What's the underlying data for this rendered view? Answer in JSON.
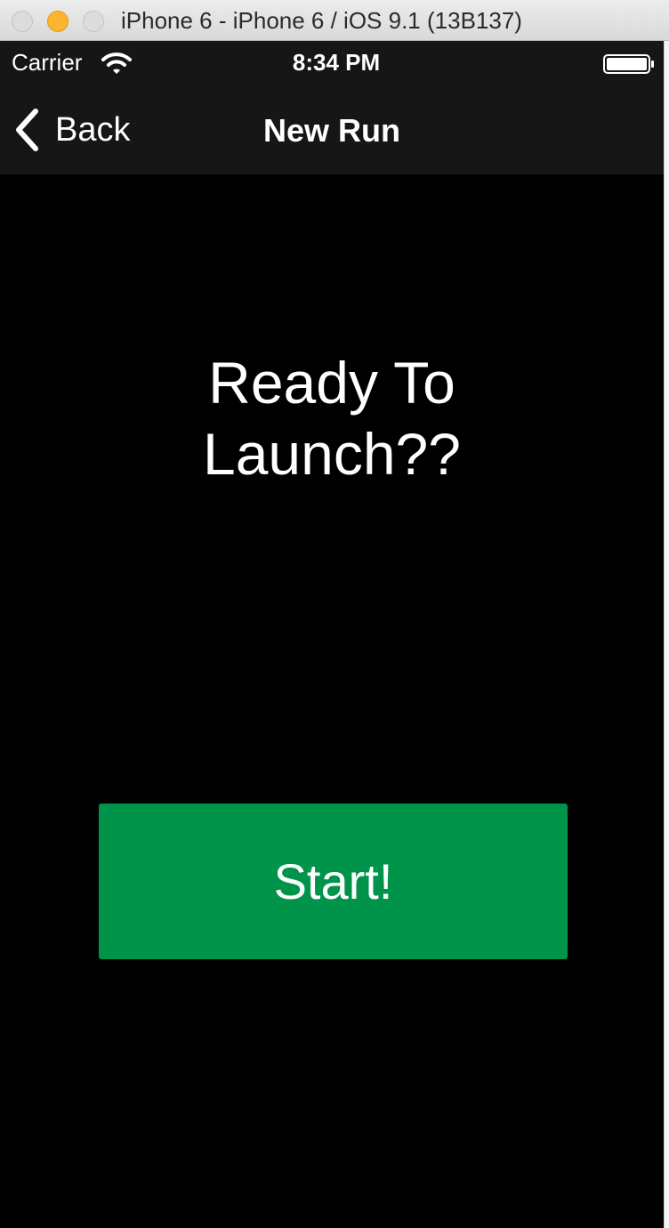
{
  "window": {
    "title": "iPhone 6 - iPhone 6 / iOS 9.1 (13B137)"
  },
  "status_bar": {
    "carrier": "Carrier",
    "time": "8:34 PM",
    "wifi_icon": "wifi-icon",
    "battery_icon": "battery-icon"
  },
  "nav_bar": {
    "back_label": "Back",
    "back_icon": "chevron-left-icon",
    "title": "New Run"
  },
  "main": {
    "headline_line1": "Ready To",
    "headline_line2": "Launch??",
    "start_label": "Start!"
  },
  "colors": {
    "screen_background": "#000000",
    "bar_background": "#161616",
    "start_button": "#00944a",
    "minimize_button": "#fcb52f"
  }
}
